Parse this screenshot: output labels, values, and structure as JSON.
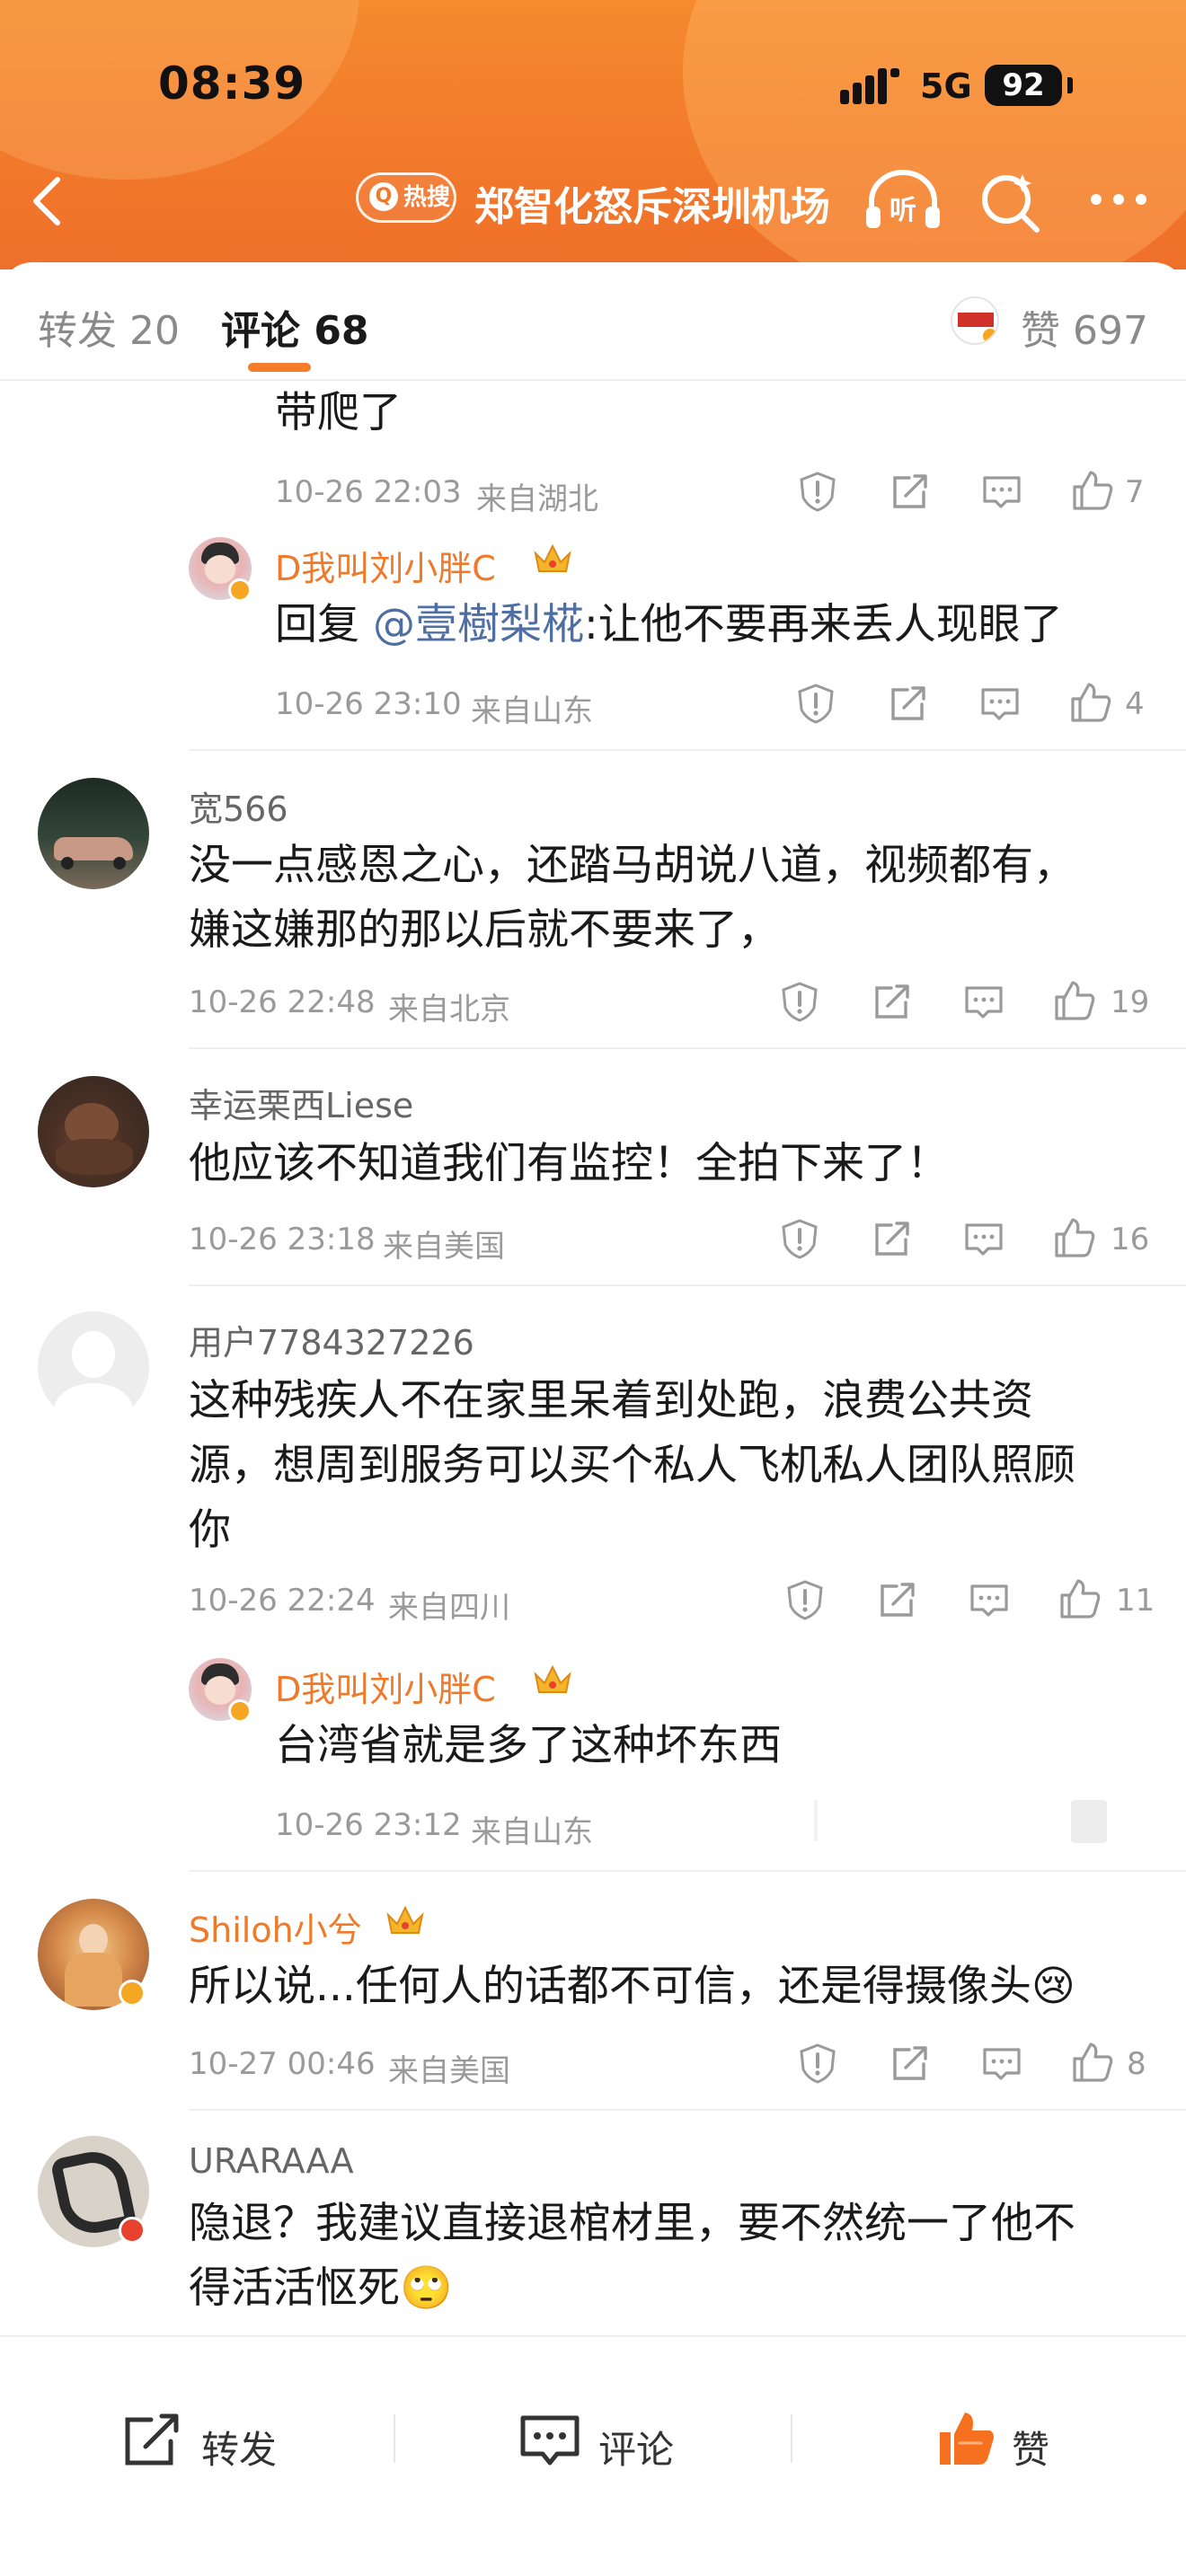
{
  "status": {
    "time": "08:39",
    "network": "5G",
    "battery": "92"
  },
  "nav": {
    "hot_badge": "热搜",
    "title": "郑智化怒斥深圳机场",
    "listen_label": "听"
  },
  "tabs": {
    "repost": "转发 20",
    "comment": "评论 68",
    "like": "赞 697"
  },
  "comments": [
    {
      "text": "带爬了",
      "time": "10-26 22:03",
      "location": "来自湖北",
      "likes": "7"
    },
    {
      "user": "D我叫刘小胖C",
      "reply_prefix": "回复 ",
      "mention": "@壹樹梨椛",
      "reply_text": ":让他不要再来丢人现眼了",
      "time": "10-26 23:10",
      "location": "来自山东",
      "likes": "4"
    },
    {
      "user": "宽566",
      "lines": [
        "没一点感恩之心，还踏马胡说八道，视频都有，",
        "嫌这嫌那的那以后就不要来了，"
      ],
      "time": "10-26 22:48",
      "location": "来自北京",
      "likes": "19"
    },
    {
      "user": "幸运栗西Liese",
      "lines": [
        "他应该不知道我们有监控！全拍下来了！"
      ],
      "time": "10-26 23:18",
      "location": "来自美国",
      "likes": "16"
    },
    {
      "user": "用户7784327226",
      "lines": [
        "这种残疾人不在家里呆着到处跑，浪费公共资",
        "源，想周到服务可以买个私人飞机私人团队照顾",
        "你"
      ],
      "time": "10-26 22:24",
      "location": "来自四川",
      "likes": "11"
    },
    {
      "user": "D我叫刘小胖C",
      "text": "台湾省就是多了这种坏东西",
      "time": "10-26 23:12",
      "location": "来自山东"
    },
    {
      "user": "Shiloh小兮",
      "text": "所以说...任何人的话都不可信，还是得摄像头",
      "emoji": "😢",
      "time": "10-27 00:46",
      "location": "来自美国",
      "likes": "8"
    },
    {
      "user": "URARAAA",
      "lines": [
        "隐退？我建议直接退棺材里，要不然统一了他不",
        "得活活怄死"
      ],
      "emoji": "🙄"
    }
  ],
  "bottom_bar": {
    "repost": "转发",
    "comment": "评论",
    "like": "赞"
  },
  "colors": {
    "accent": "#f57c2b",
    "mention": "#4f6fa3",
    "like_active": "#f5711f"
  }
}
